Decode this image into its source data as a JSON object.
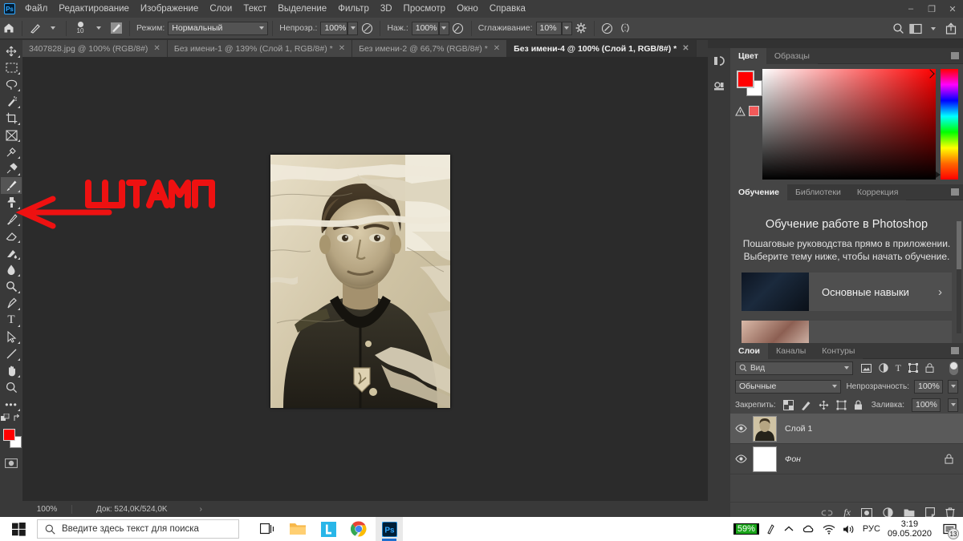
{
  "app": {
    "logo": "Ps"
  },
  "menubar": {
    "items": [
      "Файл",
      "Редактирование",
      "Изображение",
      "Слои",
      "Текст",
      "Выделение",
      "Фильтр",
      "3D",
      "Просмотр",
      "Окно",
      "Справка"
    ],
    "window_controls": [
      "minimize",
      "restore",
      "close"
    ]
  },
  "options_bar": {
    "home_icon": "home-icon",
    "brush_preset_icon": "brush-preset-icon",
    "brush_size": "10",
    "toggle_panel_icon": "brush-panel-icon",
    "mode_label": "Режим:",
    "mode_value": "Нормальный",
    "opacity_label": "Непрозр.:",
    "opacity_value": "100%",
    "pressure_opacity_icon": "pressure-opacity-icon",
    "flow_label": "Наж.:",
    "flow_value": "100%",
    "airbrush_icon": "airbrush-icon",
    "smoothing_label": "Сглаживание:",
    "smoothing_value": "10%",
    "gear_icon": "gear-icon",
    "pressure_size_icon": "pressure-size-icon",
    "symmetry_icon": "symmetry-icon",
    "right_icons": [
      "search-icon",
      "workspace-icon",
      "chevron-down-icon",
      "share-icon"
    ]
  },
  "tabs": [
    {
      "label": "3407828.jpg @ 100% (RGB/8#)",
      "active": false
    },
    {
      "label": "Без имени-1 @ 139% (Слой 1, RGB/8#) *",
      "active": false
    },
    {
      "label": "Без имени-2 @ 66,7% (RGB/8#) *",
      "active": false
    },
    {
      "label": "Без имени-4 @ 100% (Слой 1, RGB/8#) *",
      "active": true
    }
  ],
  "toolbar": {
    "tools": [
      {
        "name": "move-tool",
        "glyph": "✥",
        "active": false
      },
      {
        "name": "rectangular-marquee-tool",
        "glyph": "▭",
        "active": false
      },
      {
        "name": "lasso-tool",
        "glyph": "◯",
        "active": false
      },
      {
        "name": "magic-wand-tool",
        "glyph": "✨",
        "active": false
      },
      {
        "name": "crop-tool",
        "glyph": "⌗",
        "active": false
      },
      {
        "name": "frame-tool",
        "glyph": "⊠",
        "active": false
      },
      {
        "name": "eyedropper-tool",
        "glyph": "✎",
        "active": false
      },
      {
        "name": "spot-healing-brush-tool",
        "glyph": "✇",
        "active": false
      },
      {
        "name": "brush-tool",
        "glyph": "✏",
        "active": true
      },
      {
        "name": "clone-stamp-tool",
        "glyph": "⌶",
        "active": false
      },
      {
        "name": "history-brush-tool",
        "glyph": "✒",
        "active": false
      },
      {
        "name": "eraser-tool",
        "glyph": "◳",
        "active": false
      },
      {
        "name": "gradient-tool",
        "glyph": "◧",
        "active": false
      },
      {
        "name": "blur-tool",
        "glyph": "💧",
        "active": false
      },
      {
        "name": "dodge-tool",
        "glyph": "◔",
        "active": false
      },
      {
        "name": "pen-tool",
        "glyph": "✐",
        "active": false
      },
      {
        "name": "type-tool",
        "glyph": "T",
        "active": false
      },
      {
        "name": "path-selection-tool",
        "glyph": "➤",
        "active": false
      },
      {
        "name": "line-tool",
        "glyph": "╱",
        "active": false
      },
      {
        "name": "hand-tool",
        "glyph": "✋",
        "active": false
      },
      {
        "name": "zoom-tool",
        "glyph": "🔍",
        "active": false
      },
      {
        "name": "edit-toolbar-button",
        "glyph": "•••",
        "active": false
      }
    ],
    "foreground_color": "#ff0000",
    "background_color": "#ffffff"
  },
  "annotation": {
    "text": "ШТАМП",
    "color": "#ee1111",
    "arrow": "arrow-pointing-to-clone-stamp-tool"
  },
  "canvas": {
    "image_description": "Старое повреждённое фото солдата в сепии"
  },
  "status_bar": {
    "zoom": "100%",
    "doc_label": "Док:",
    "doc_value": "524,0K/524,0K",
    "arrow": "›"
  },
  "rail": {
    "buttons": [
      "history-panel-icon",
      "properties-panel-icon"
    ]
  },
  "color_panel": {
    "tabs": [
      {
        "label": "Цвет",
        "active": true
      },
      {
        "label": "Образцы",
        "active": false
      }
    ],
    "foreground": "#ff0000",
    "background": "#ffffff",
    "out_of_gamut_swatch": "#f25a5a",
    "menu_icon": "panel-menu-icon"
  },
  "learn_panel": {
    "tabs": [
      {
        "label": "Обучение",
        "active": true
      },
      {
        "label": "Библиотеки",
        "active": false
      },
      {
        "label": "Коррекция",
        "active": false
      }
    ],
    "heading": "Обучение работе в Photoshop",
    "paragraph": "Пошаговые руководства прямо в приложении. Выберите тему ниже, чтобы начать обучение.",
    "cards": [
      {
        "title": "Основные навыки",
        "chevron": "›"
      }
    ],
    "menu_icon": "panel-menu-icon"
  },
  "layers_panel": {
    "tabs": [
      {
        "label": "Слои",
        "active": true
      },
      {
        "label": "Каналы",
        "active": false
      },
      {
        "label": "Контуры",
        "active": false
      }
    ],
    "filter_placeholder": "Вид",
    "filter_icons": [
      "pixel-filter-icon",
      "adjustment-filter-icon",
      "type-filter-icon",
      "shape-filter-icon",
      "smart-object-filter-icon"
    ],
    "blend_mode": "Обычные",
    "opacity_label": "Непрозрачность:",
    "opacity_value": "100%",
    "lock_label": "Закрепить:",
    "lock_icons": [
      "lock-transparency-icon",
      "lock-image-icon",
      "lock-position-icon",
      "lock-artboard-icon",
      "lock-all-icon"
    ],
    "fill_label": "Заливка:",
    "fill_value": "100%",
    "layers": [
      {
        "name": "Слой 1",
        "selected": true,
        "locked": false,
        "visible": true,
        "italic": false
      },
      {
        "name": "Фон",
        "selected": false,
        "locked": true,
        "visible": true,
        "italic": true
      }
    ],
    "footer_icons": [
      "link-layers-icon",
      "layer-style-icon",
      "layer-mask-icon",
      "adjustment-layer-icon",
      "new-group-icon",
      "new-layer-icon",
      "delete-layer-icon"
    ],
    "menu_icon": "panel-menu-icon"
  },
  "taskbar": {
    "start_icon": "windows-start-icon",
    "search_placeholder": "Введите здесь текст для поиска",
    "search_icon": "search-icon",
    "task_view_icon": "task-view-icon",
    "apps": [
      {
        "name": "file-explorer-icon"
      },
      {
        "name": "lightshot-icon"
      },
      {
        "name": "chrome-icon"
      },
      {
        "name": "photoshop-icon"
      }
    ],
    "tray": {
      "battery_percent": "59%",
      "hidden_icons_icon": "chevron-up-icon",
      "onedrive_icon": "onedrive-icon",
      "network_icon": "wifi-icon",
      "volume_icon": "volume-icon",
      "language": "РУС",
      "time": "3:19",
      "date": "09.05.2020",
      "notification_count": "13"
    }
  }
}
